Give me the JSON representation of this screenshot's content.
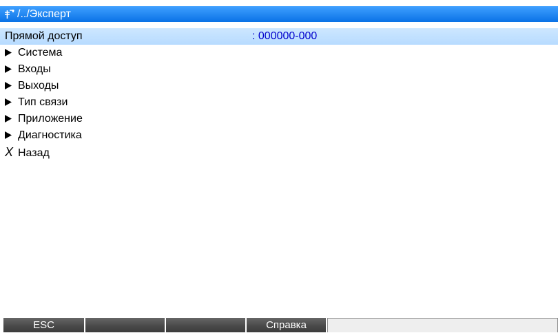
{
  "header": {
    "path": "/../Эксперт",
    "icon": "expert-key-icon"
  },
  "menu": {
    "direct_access": {
      "label": "Прямой доступ",
      "value": ": 000000-000"
    },
    "items": [
      {
        "label": "Система",
        "icon": "arrow-right-icon"
      },
      {
        "label": "Входы",
        "icon": "arrow-right-icon"
      },
      {
        "label": "Выходы",
        "icon": "arrow-right-icon"
      },
      {
        "label": "Тип связи",
        "icon": "arrow-right-icon"
      },
      {
        "label": "Приложение",
        "icon": "arrow-right-icon"
      },
      {
        "label": "Диагностика",
        "icon": "arrow-right-icon"
      }
    ],
    "back": {
      "symbol": "X",
      "label": "Назад"
    }
  },
  "softkeys": {
    "key1": "ESC",
    "key2": "",
    "key3": "",
    "key4": "Справка",
    "info": ""
  },
  "colors": {
    "title_bar": "#0a72e6",
    "selection": "#b7dbff",
    "value_text": "#0000cc",
    "softkey": "#4a4a4a"
  }
}
